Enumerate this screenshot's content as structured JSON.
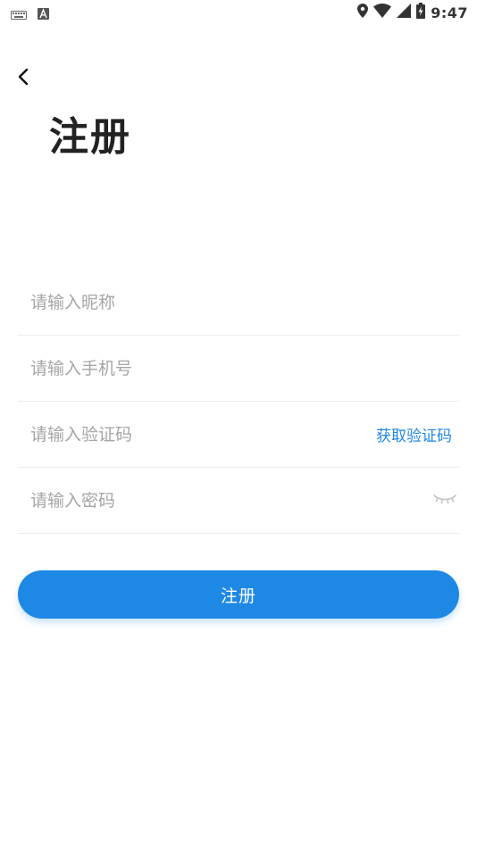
{
  "status_bar": {
    "time": "9:47",
    "icons_left": [
      "keyboard-icon",
      "font-a-icon"
    ],
    "icons_right": [
      "location-icon",
      "wifi-icon",
      "signal-icon",
      "battery-icon"
    ]
  },
  "header": {
    "back_icon": "chevron-left-icon",
    "title": "注册"
  },
  "form": {
    "nickname": {
      "value": "",
      "placeholder": "请输入昵称"
    },
    "phone": {
      "value": "",
      "placeholder": "请输入手机号"
    },
    "code": {
      "value": "",
      "placeholder": "请输入验证码",
      "action_label": "获取验证码"
    },
    "password": {
      "value": "",
      "placeholder": "请输入密码",
      "toggle_icon": "eye-closed-icon"
    }
  },
  "submit": {
    "label": "注册"
  },
  "colors": {
    "accent": "#1e88e5",
    "placeholder": "#a6a6a6",
    "divider": "#ececec",
    "title": "#222222"
  }
}
